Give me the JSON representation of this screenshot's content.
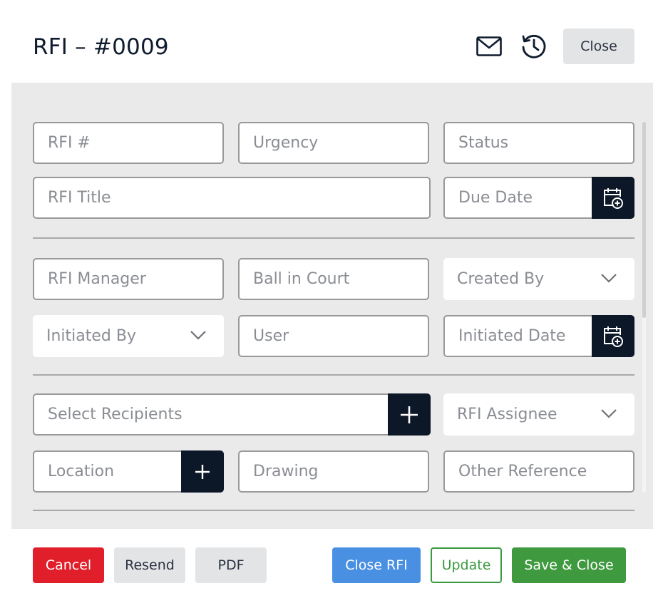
{
  "header": {
    "title": "RFI – #0009",
    "mail_icon": "envelope-icon",
    "history_icon": "history-clock-icon",
    "close_label": "Close"
  },
  "form": {
    "rfi_number": {
      "placeholder": "RFI #",
      "value": ""
    },
    "urgency": {
      "placeholder": "Urgency",
      "value": ""
    },
    "status": {
      "placeholder": "Status",
      "value": ""
    },
    "rfi_title": {
      "placeholder": "RFI Title",
      "value": ""
    },
    "due_date": {
      "placeholder": "Due Date",
      "value": ""
    },
    "rfi_manager": {
      "placeholder": "RFI Manager",
      "value": ""
    },
    "ball_in_court": {
      "placeholder": "Ball in Court",
      "value": ""
    },
    "created_by": {
      "label": "Created By"
    },
    "initiated_by": {
      "label": "Initiated By"
    },
    "user": {
      "placeholder": "User",
      "value": ""
    },
    "initiated_date": {
      "placeholder": "Initiated Date",
      "value": ""
    },
    "select_recipients": {
      "placeholder": "Select Recipients",
      "value": ""
    },
    "rfi_assignee": {
      "label": "RFI Assignee"
    },
    "location": {
      "placeholder": "Location",
      "value": ""
    },
    "drawing": {
      "placeholder": "Drawing",
      "value": ""
    },
    "other_reference": {
      "placeholder": "Other Reference",
      "value": ""
    }
  },
  "footer": {
    "cancel_label": "Cancel",
    "resend_label": "Resend",
    "pdf_label": "PDF",
    "close_rfi_label": "Close RFI",
    "update_label": "Update",
    "save_close_label": "Save & Close"
  },
  "colors": {
    "dark_navy": "#0c1727",
    "danger": "#e01f2b",
    "primary": "#4a90e2",
    "success": "#3f9a3f",
    "panel_bg": "#ebeaeb"
  }
}
